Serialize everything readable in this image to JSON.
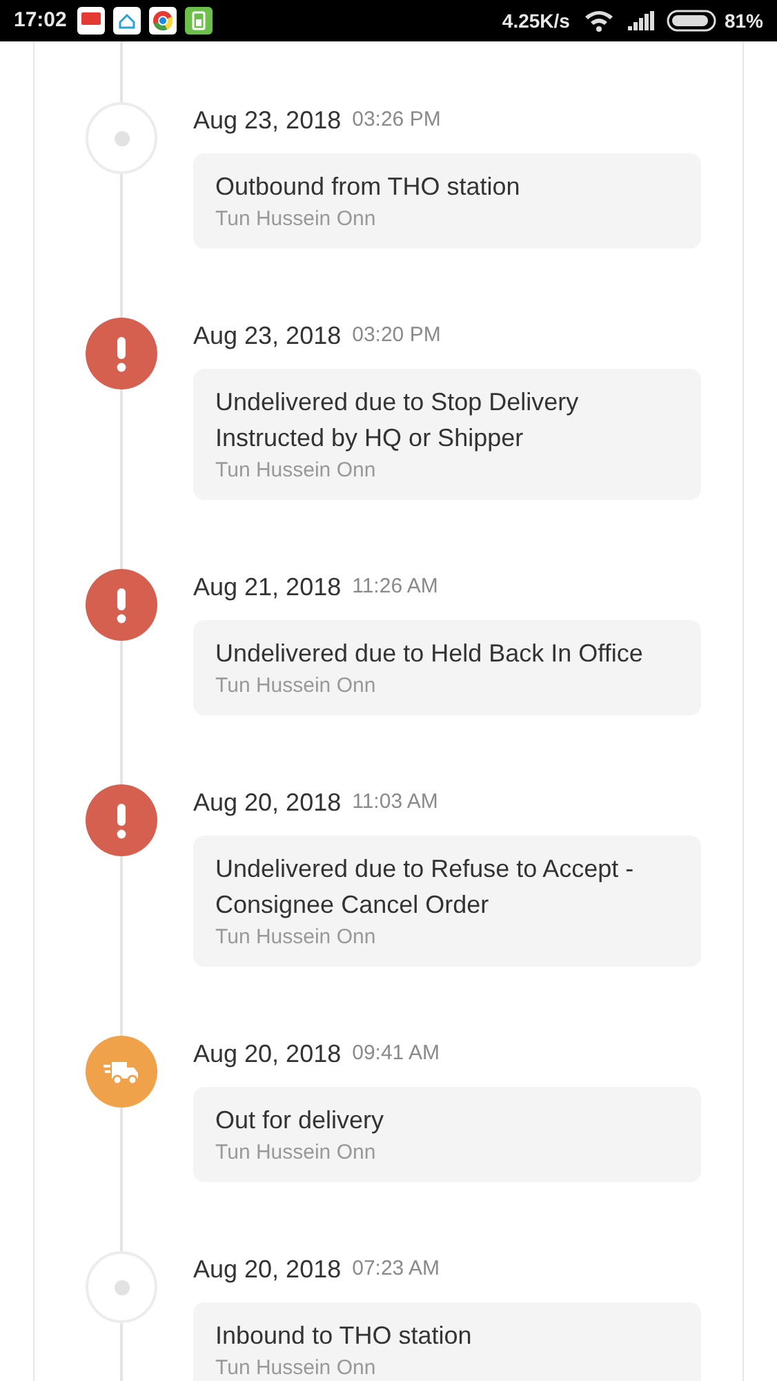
{
  "status_bar": {
    "time": "17:02",
    "apps": [
      {
        "kind": "red"
      },
      {
        "kind": "home"
      },
      {
        "kind": "browser"
      },
      {
        "kind": "battery-app"
      }
    ],
    "speed": "4.25K/s",
    "battery": "81%"
  },
  "events": [
    {
      "kind": "pending",
      "date": "Aug 23, 2018",
      "time": "03:26 PM",
      "title": "Outbound from THO station",
      "location": "Tun Hussein Onn"
    },
    {
      "kind": "alert",
      "date": "Aug 23, 2018",
      "time": "03:20 PM",
      "title": "Undelivered due to Stop Delivery Instructed by HQ or Shipper",
      "location": "Tun Hussein Onn"
    },
    {
      "kind": "alert",
      "date": "Aug 21, 2018",
      "time": "11:26 AM",
      "title": "Undelivered due to Held Back In Office",
      "location": "Tun Hussein Onn"
    },
    {
      "kind": "alert",
      "date": "Aug 20, 2018",
      "time": "11:03 AM",
      "title": "Undelivered due to Refuse to Accept - Consignee Cancel Order",
      "location": "Tun Hussein Onn"
    },
    {
      "kind": "delivery",
      "date": "Aug 20, 2018",
      "time": "09:41 AM",
      "title": "Out for delivery",
      "location": "Tun Hussein Onn"
    },
    {
      "kind": "pending",
      "date": "Aug 20, 2018",
      "time": "07:23 AM",
      "title": "Inbound to THO station",
      "location": "Tun Hussein Onn"
    }
  ]
}
